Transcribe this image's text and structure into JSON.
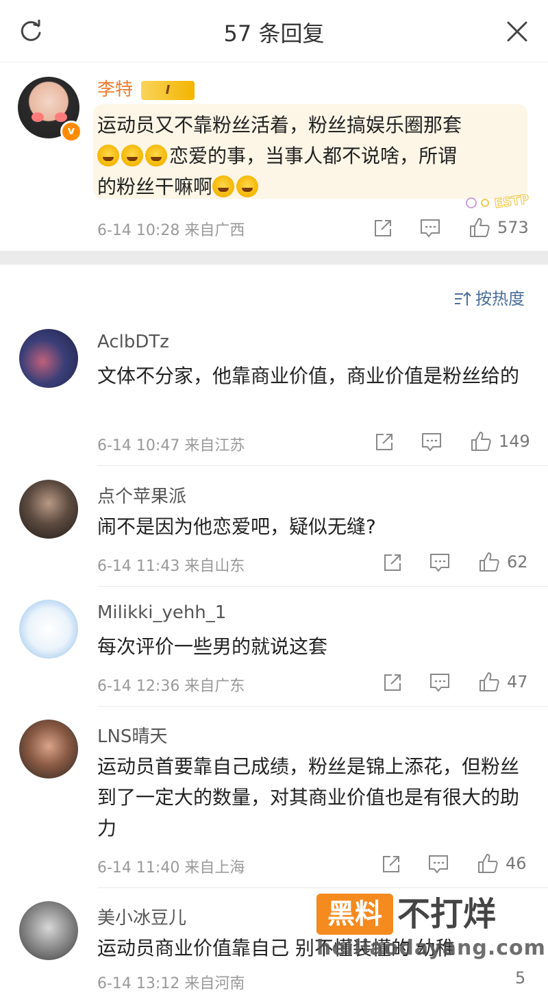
{
  "header": {
    "title": "57 条回复"
  },
  "main_comment": {
    "author": "李特",
    "badge_text": "I",
    "text": "运动员又不靠粉丝活着，粉丝搞娱乐圈那套",
    "text_line2": "恋爱的事，当事人都不说啥，所谓",
    "text_line3": "的粉丝干嘛啊",
    "sticker_text": "ESTP",
    "time_location": "6-14 10:28  来自广西",
    "likes": "573"
  },
  "sort": {
    "label": "按热度"
  },
  "replies": [
    {
      "author": "AclbDTz",
      "text": "文体不分家，他靠商业价值，商业价值是粉丝给的",
      "time_location": "6-14 10:47  来自江苏",
      "likes": "149"
    },
    {
      "author": "点个苹果派",
      "text": "闹不是因为他恋爱吧，疑似无缝?",
      "time_location": "6-14 11:43  来自山东",
      "likes": "62"
    },
    {
      "author": "Milikki_yehh_1",
      "text": "每次评价一些男的就说这套",
      "time_location": "6-14 12:36  来自广东",
      "likes": "47"
    },
    {
      "author": "LNS晴天",
      "text": "运动员首要靠自己成绩，粉丝是锦上添花，但粉丝到了一定大的数量，对其商业价值也是有很大的助力",
      "time_location": "6-14 11:40  来自上海",
      "likes": "46"
    },
    {
      "author": "美小冰豆儿",
      "text": "运动员商业价值靠自己 别不懂装懂的 幼稚",
      "time_location": "6-14 13:12  来自河南",
      "likes": "5"
    }
  ],
  "watermark": {
    "box_text": "黑料",
    "text": "不打烊",
    "url": "heiliaodayang.com"
  },
  "colors": {
    "accent_name": "#f07b2f",
    "link_blue": "#4a6f9a",
    "bubble": "#fdf5e6",
    "watermark_orange": "#f58a1f"
  },
  "icons": [
    "refresh-icon",
    "close-icon",
    "share-icon",
    "comment-icon",
    "like-icon",
    "sort-icon",
    "verified-icon",
    "crown-badge-icon"
  ]
}
